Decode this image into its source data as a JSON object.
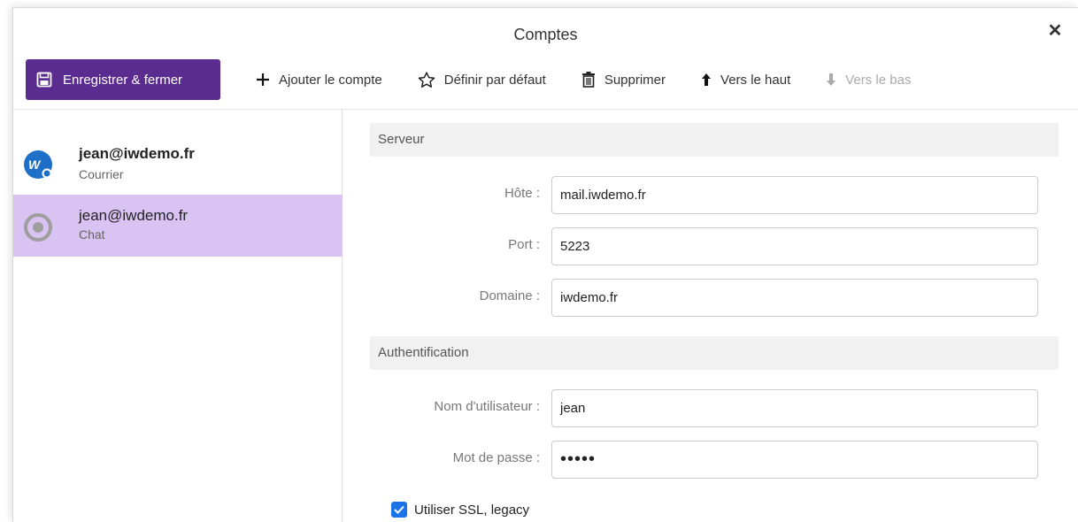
{
  "window": {
    "title": "Comptes"
  },
  "toolbar": {
    "save_close": "Enregistrer & fermer",
    "add_account": "Ajouter le compte",
    "set_default": "Définir par défaut",
    "delete": "Supprimer",
    "move_up": "Vers le haut",
    "move_down": "Vers le bas"
  },
  "accounts": [
    {
      "email": "jean@iwdemo.fr",
      "type": "Courrier",
      "icon": "mail-account-icon",
      "selected": false
    },
    {
      "email": "jean@iwdemo.fr",
      "type": "Chat",
      "icon": "chat-account-icon",
      "selected": true
    }
  ],
  "server": {
    "section_title": "Serveur",
    "host_label": "Hôte :",
    "host_value": "mail.iwdemo.fr",
    "port_label": "Port :",
    "port_value": "5223",
    "domain_label": "Domaine :",
    "domain_value": "iwdemo.fr"
  },
  "auth": {
    "section_title": "Authentification",
    "username_label": "Nom d'utilisateur :",
    "username_value": "jean",
    "password_label": "Mot de passe :",
    "password_value": "•••••",
    "ssl_label": "Utiliser SSL, legacy",
    "ssl_checked": true
  },
  "colors": {
    "primary": "#5b2c8f",
    "selected_row": "#d8c3f2",
    "checkbox": "#1a73e8"
  }
}
